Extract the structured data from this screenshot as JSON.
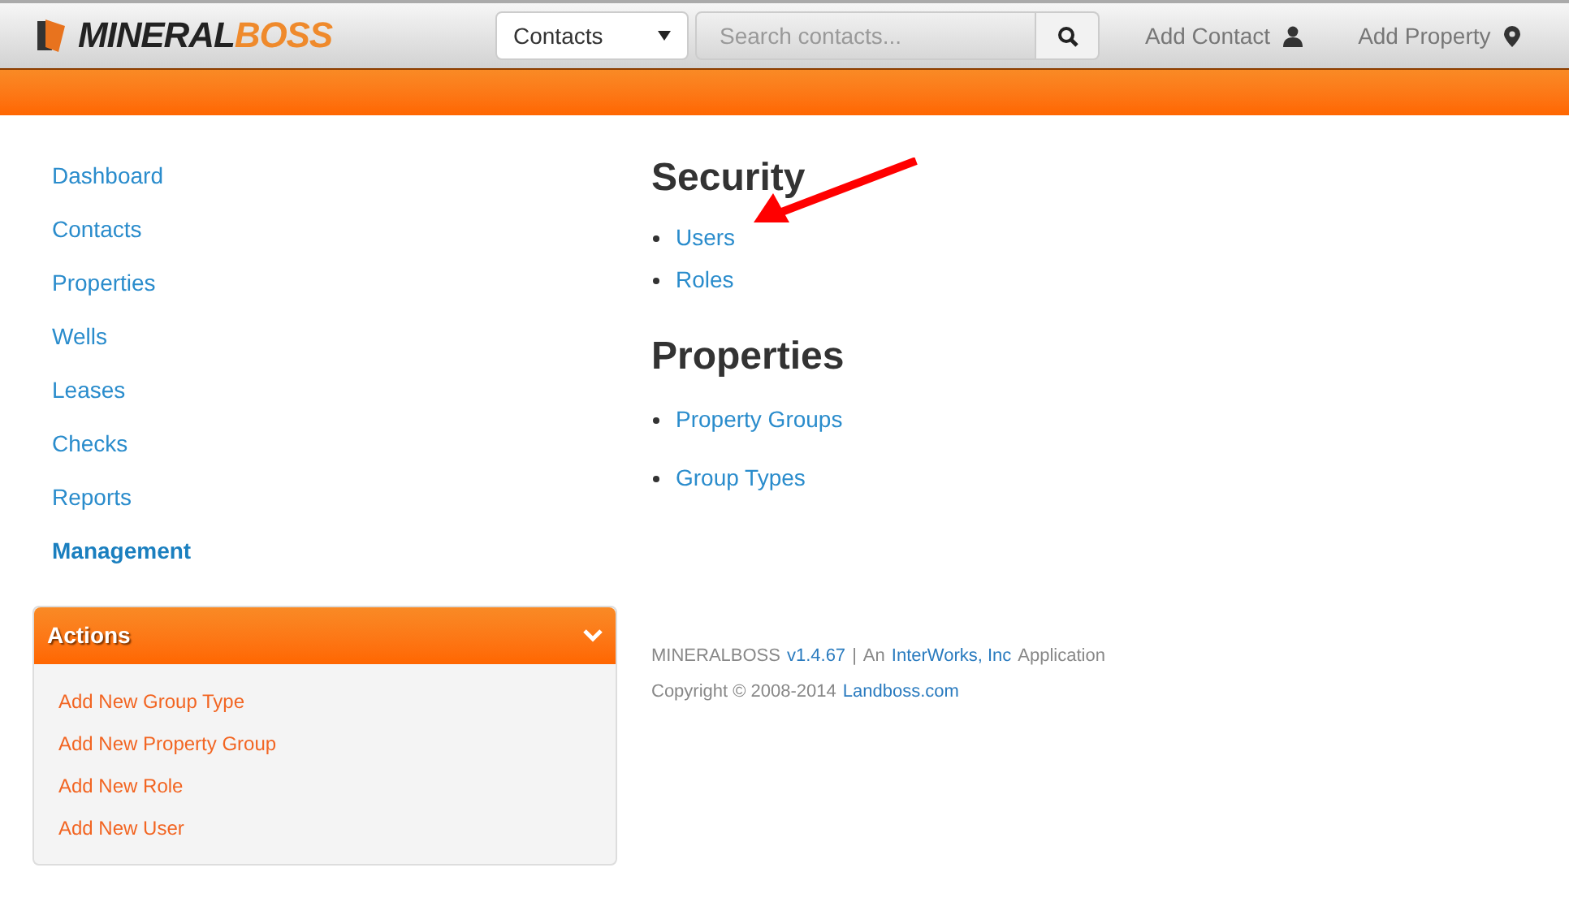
{
  "header": {
    "logo": {
      "dark": "MINERAL",
      "accent": "BOSS"
    },
    "search_scope": "Contacts",
    "search": {
      "placeholder": "Search contacts..."
    },
    "actions": [
      {
        "label": "Add Contact",
        "kind": "person"
      },
      {
        "label": "Add Property",
        "kind": "pin"
      }
    ]
  },
  "sidebar": {
    "items": [
      {
        "label": "Dashboard",
        "selected": false
      },
      {
        "label": "Contacts",
        "selected": false
      },
      {
        "label": "Properties",
        "selected": false
      },
      {
        "label": "Wells",
        "selected": false
      },
      {
        "label": "Leases",
        "selected": false
      },
      {
        "label": "Checks",
        "selected": false
      },
      {
        "label": "Reports",
        "selected": false
      },
      {
        "label": "Management",
        "selected": true
      }
    ],
    "actions_panel": {
      "title": "Actions",
      "expanded": true,
      "items": [
        "Add New Group Type",
        "Add New Property Group",
        "Add New Role",
        "Add New User"
      ]
    }
  },
  "sections": [
    {
      "title": "Security",
      "links": [
        {
          "label": "Users",
          "pointed_at": true
        },
        {
          "label": "Roles",
          "pointed_at": false
        }
      ]
    },
    {
      "title": "Properties",
      "links": [
        {
          "label": "Property Groups",
          "pointed_at": false
        },
        {
          "label": "Group Types",
          "pointed_at": false
        }
      ]
    }
  ],
  "footer": {
    "lines": [
      [
        {
          "kind": "text",
          "text": "MINERALBOSS"
        },
        {
          "kind": "link",
          "text": "v1.4.67"
        },
        {
          "kind": "text",
          "text": "|"
        },
        {
          "kind": "text",
          "text": "An"
        },
        {
          "kind": "link",
          "text": "InterWorks, Inc"
        },
        {
          "kind": "text",
          "text": "Application"
        }
      ],
      [
        {
          "kind": "text",
          "text": "Copyright © 2008-2014"
        },
        {
          "kind": "link",
          "text": "Landboss.com"
        }
      ]
    ]
  }
}
